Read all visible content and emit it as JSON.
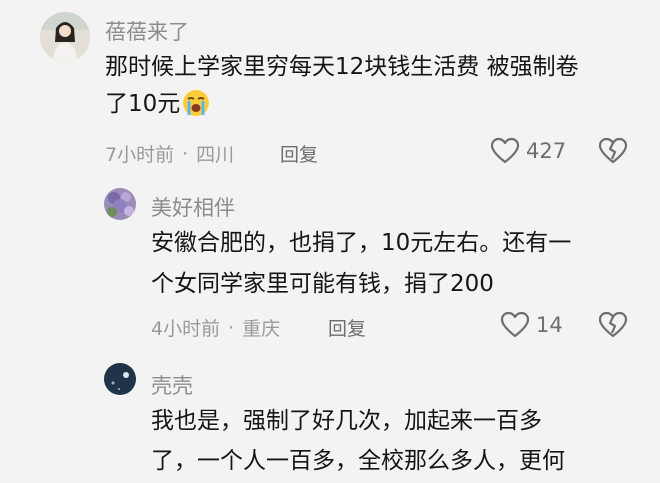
{
  "comments": [
    {
      "username": "蓓蓓来了",
      "text_line1": "那时候上学家里穷每天12块钱生活费 被强制卷",
      "text_line2": "了10元",
      "emoji": "crying-face",
      "time": "7小时前",
      "location": "四川",
      "reply_label": "回复",
      "likes": "427"
    },
    {
      "username": "美好相伴",
      "text_line1": "安徽合肥的，也捐了，10元左右。还有一",
      "text_line2": "个女同学家里可能有钱，捐了200",
      "time": "4小时前",
      "location": "重庆",
      "reply_label": "回复",
      "likes": "14"
    },
    {
      "username": "壳壳",
      "text_line1": "我也是，强制了好几次，加起来一百多",
      "text_line2": "了，一个人一百多，全校那么多人，更何"
    }
  ],
  "separator": "·",
  "colors": {
    "background": "#f3f3f3",
    "text": "#151515",
    "muted": "#9a9a9a"
  }
}
